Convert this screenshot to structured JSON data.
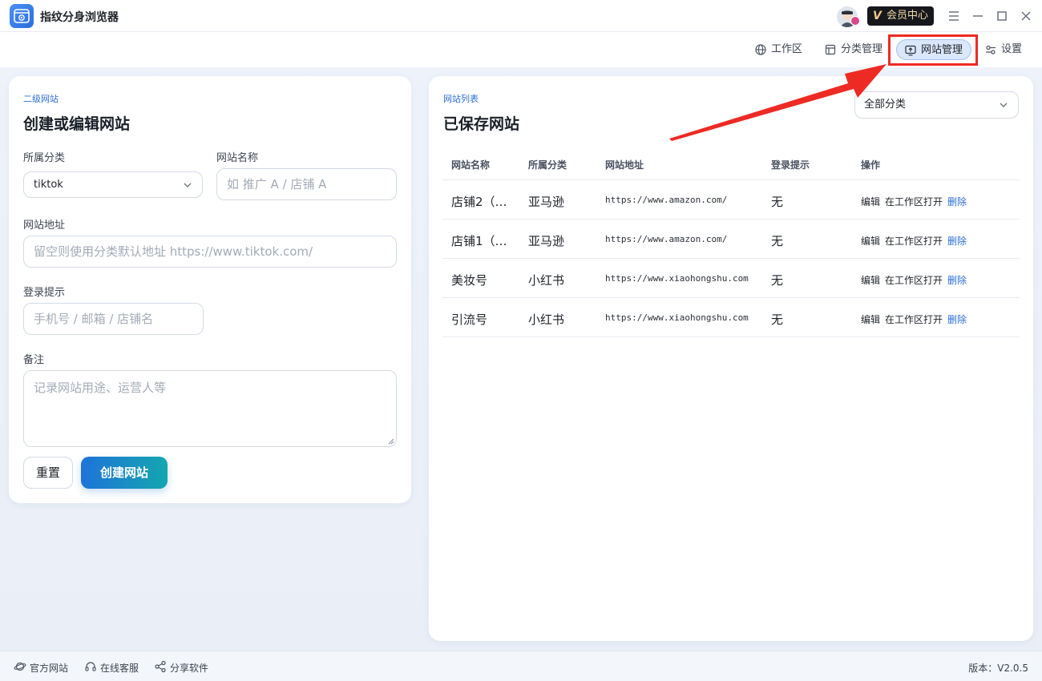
{
  "titlebar": {
    "app_title": "指纹分身浏览器",
    "vip_mark": "V",
    "vip_label": "会员中心"
  },
  "nav": {
    "items": [
      {
        "label": "工作区",
        "icon": "globe-icon"
      },
      {
        "label": "分类管理",
        "icon": "layout-icon"
      },
      {
        "label": "网站管理",
        "icon": "monitor-upload-icon",
        "active": true
      },
      {
        "label": "设置",
        "icon": "sliders-icon"
      }
    ]
  },
  "form": {
    "eyebrow": "二级网站",
    "title": "创建或编辑网站",
    "category_label": "所属分类",
    "category_value": "tiktok",
    "name_label": "网站名称",
    "name_placeholder": "如 推广 A / 店铺 A",
    "url_label": "网站地址",
    "url_placeholder": "留空则使用分类默认地址 https://www.tiktok.com/",
    "login_label": "登录提示",
    "login_placeholder": "手机号 / 邮箱 / 店铺名",
    "note_label": "备注",
    "note_placeholder": "记录网站用途、运营人等",
    "reset_label": "重置",
    "create_label": "创建网站"
  },
  "list": {
    "eyebrow": "网站列表",
    "title": "已保存网站",
    "filter_value": "全部分类",
    "columns": [
      "网站名称",
      "所属分类",
      "网站地址",
      "登录提示",
      "操作"
    ],
    "rows": [
      {
        "name": "店铺2（…",
        "category": "亚马逊",
        "url": "https://www.amazon.com/",
        "login": "无"
      },
      {
        "name": "店铺1（…",
        "category": "亚马逊",
        "url": "https://www.amazon.com/",
        "login": "无"
      },
      {
        "name": "美妆号",
        "category": "小红书",
        "url": "https://www.xiaohongshu.com",
        "login": "无"
      },
      {
        "name": "引流号",
        "category": "小红书",
        "url": "https://www.xiaohongshu.com",
        "login": "无"
      }
    ],
    "actions": {
      "edit": "编辑",
      "open": "在工作区打开",
      "delete": "删除"
    }
  },
  "footer": {
    "official_site": "官方网站",
    "online_service": "在线客服",
    "share": "分享软件",
    "version": "版本：V2.0.5"
  },
  "colors": {
    "accent": "#2b6fd6",
    "annotation_red": "#ee2a24",
    "vip_bg": "#16181d"
  }
}
